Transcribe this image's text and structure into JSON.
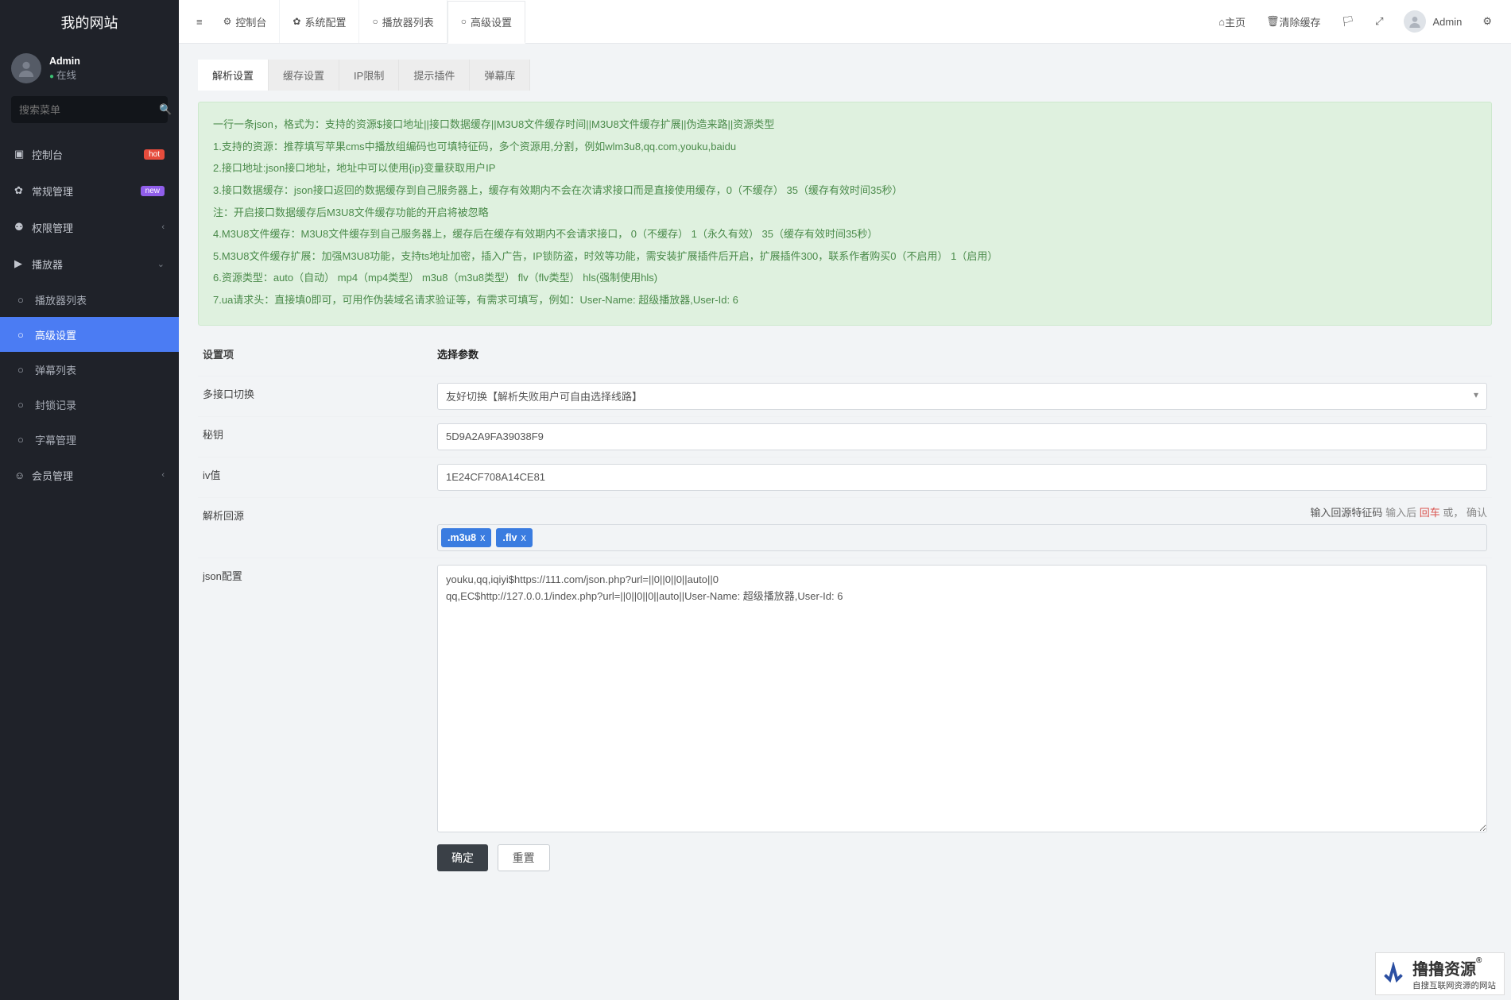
{
  "brand": "我的网站",
  "user": {
    "name": "Admin",
    "status": "在线",
    "dot": "●"
  },
  "search": {
    "placeholder": "搜索菜单"
  },
  "nav": [
    {
      "label": "控制台",
      "badge": "hot",
      "icon": "▣"
    },
    {
      "label": "常规管理",
      "badge": "new",
      "icon": "✿"
    },
    {
      "label": "权限管理",
      "expandable": true,
      "icon": "⚉"
    },
    {
      "label": "播放器",
      "expanded": true,
      "icon": "▶",
      "children": [
        {
          "label": "播放器列表",
          "icon": "○"
        },
        {
          "label": "高级设置",
          "icon": "○",
          "active": true
        },
        {
          "label": "弹幕列表",
          "icon": "○"
        },
        {
          "label": "封锁记录",
          "icon": "○"
        },
        {
          "label": "字幕管理",
          "icon": "○"
        }
      ]
    },
    {
      "label": "会员管理",
      "expandable": true,
      "icon": "☺"
    }
  ],
  "topnav": {
    "menu_toggle": "≡",
    "items": [
      {
        "icon": "⚙",
        "label": "控制台"
      },
      {
        "icon": "✿",
        "label": "系统配置"
      },
      {
        "icon": "○",
        "label": "播放器列表"
      },
      {
        "icon": "○",
        "label": "高级设置",
        "active": true
      }
    ]
  },
  "topright": {
    "home": {
      "icon": "⌂",
      "label": "主页"
    },
    "clear_cache": {
      "icon": "🗑",
      "label": "清除缓存"
    },
    "lang_icon": "🏳",
    "fullscreen_icon": "⤢",
    "user_label": "Admin",
    "settings_icon": "⚙"
  },
  "subtabs": [
    {
      "label": "解析设置",
      "active": true
    },
    {
      "label": "缓存设置"
    },
    {
      "label": "IP限制"
    },
    {
      "label": "提示插件"
    },
    {
      "label": "弹幕库"
    }
  ],
  "help": [
    "一行一条json，格式为：支持的资源$接口地址||接口数据缓存||M3U8文件缓存时间||M3U8文件缓存扩展||伪造来路||资源类型",
    "1.支持的资源：推荐填写苹果cms中播放组编码也可填特征码，多个资源用,分割，例如wlm3u8,qq.com,youku,baidu",
    "2.接口地址:json接口地址，地址中可以使用{ip}变量获取用户IP",
    "3.接口数据缓存：json接口返回的数据缓存到自己服务器上，缓存有效期内不会在次请求接口而是直接使用缓存，0（不缓存） 35（缓存有效时间35秒）",
    "注：开启接口数据缓存后M3U8文件缓存功能的开启将被忽略",
    "4.M3U8文件缓存：M3U8文件缓存到自己服务器上，缓存后在缓存有效期内不会请求接口，  0（不缓存）  1（永久有效） 35（缓存有效时间35秒）",
    "5.M3U8文件缓存扩展：加强M3U8功能，支持ts地址加密，插入广告，IP锁防盗，时效等功能，需安装扩展插件后开启，扩展插件300，联系作者购买0（不启用）  1（启用）",
    "6.资源类型：auto（自动） mp4（mp4类型） m3u8（m3u8类型） flv（flv类型） hls(强制使用hls)",
    "7.ua请求头：直接填0即可，可用作伪装域名请求验证等，有需求可填写，例如：User-Name: 超级播放器,User-Id: 6"
  ],
  "form": {
    "header_label": "设置项",
    "header_control": "选择参数",
    "rows": {
      "multi_switch": {
        "label": "多接口切换",
        "select_value": "友好切换【解析失败用户可自由选择线路】"
      },
      "secret": {
        "label": "秘钥",
        "value": "5D9A2A9FA39038F9"
      },
      "iv": {
        "label": "iv值",
        "value": "1E24CF708A14CE81"
      },
      "origin": {
        "label": "解析回源",
        "hint_prefix": "输入回源特征码",
        "hint_mid": "输入后",
        "hint_enter": "回车",
        "hint_or": "或，",
        "hint_ok": "确认",
        "tags": [
          ".m3u8",
          ".flv"
        ]
      },
      "json": {
        "label": "json配置",
        "value": "youku,qq,iqiyi$https://111.com/json.php?url=||0||0||0||auto||0\nqq,EC$http://127.0.0.1/index.php?url=||0||0||0||auto||User-Name: 超级播放器,User-Id: 6"
      }
    },
    "submit": "确定",
    "reset": "重置"
  },
  "watermark": {
    "brand": "撸撸资源",
    "reg": "®",
    "sub": "自搜互联网资源的网站"
  }
}
